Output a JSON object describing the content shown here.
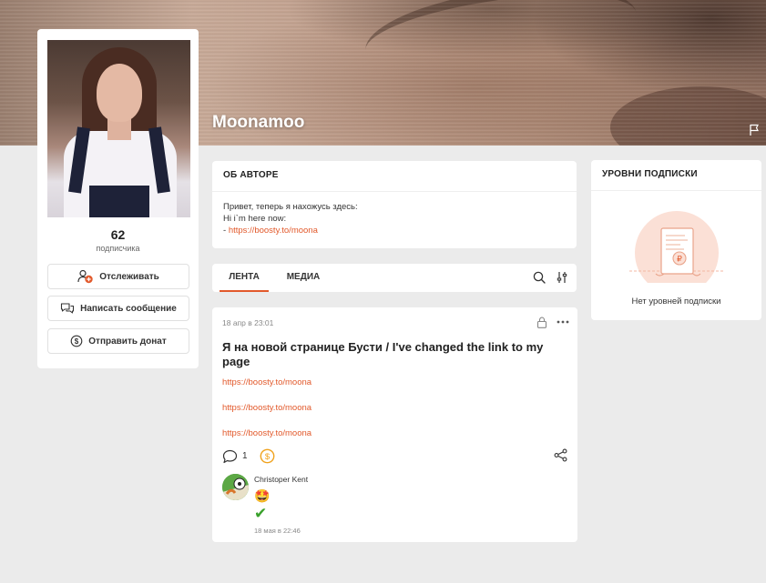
{
  "profile": {
    "username": "Moonamoo",
    "subscribers_count": "62",
    "subscribers_label": "подписчика",
    "buttons": {
      "follow": "Отслеживать",
      "message": "Написать сообщение",
      "donate": "Отправить донат"
    }
  },
  "about": {
    "heading": "ОБ АВТОРЕ",
    "line1": "Привет, теперь я нахожусь здесь:",
    "line2": "Hi i`m here now:",
    "line3_prefix": "- ",
    "line3_link": "https://boosty.to/moona"
  },
  "tabs": {
    "feed": "ЛЕНТА",
    "media": "МЕДИА"
  },
  "post": {
    "date": "18 апр в 23:01",
    "title": "Я на новой странице Бусти / I've changed the link to my page",
    "links": [
      "https://boosty.to/moona",
      "https://boosty.to/moona",
      "https://boosty.to/moona"
    ],
    "comments_count": "1",
    "comment": {
      "author": "Christoper Kent",
      "emoji": "🤩",
      "check": "✔",
      "time": "18 мая в 22:46"
    }
  },
  "tiers": {
    "heading": "УРОВНИ ПОДПИСКИ",
    "empty": "Нет уровней подписки"
  },
  "colors": {
    "accent": "#e2592b",
    "background": "#ebebeb",
    "card": "#ffffff"
  },
  "icons": [
    "flag-icon",
    "add-user-icon",
    "chat-bubbles-icon",
    "dollar-coin-icon",
    "search-icon",
    "filter-icon",
    "lock-icon",
    "more-icon",
    "comment-icon",
    "share-icon"
  ]
}
